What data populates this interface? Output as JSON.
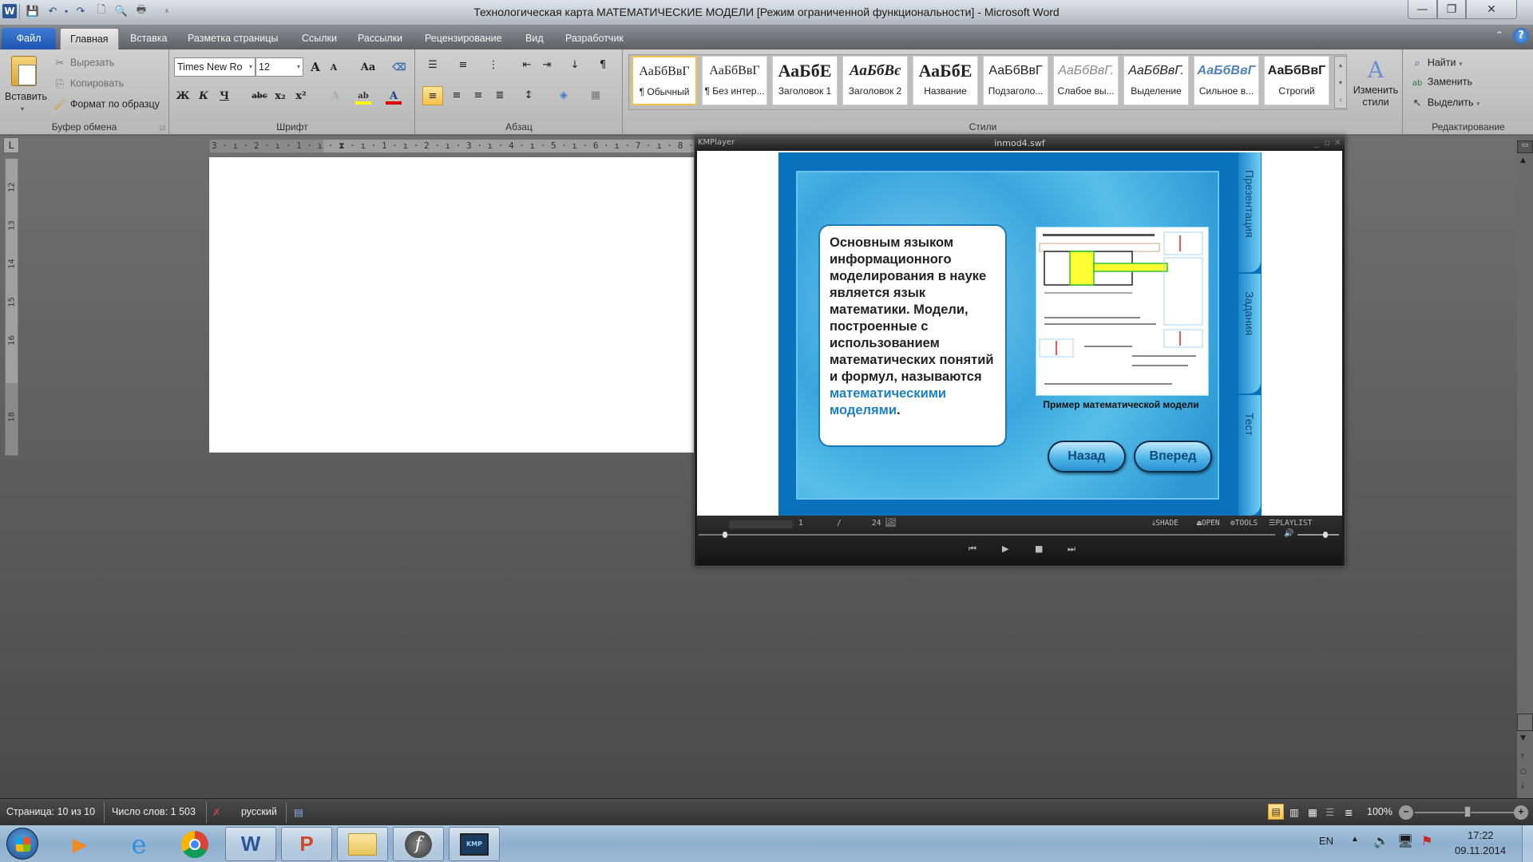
{
  "word": {
    "title": "Технологическая карта МАТЕМАТИЧЕСКИЕ  МОДЕЛИ [Режим ограниченной функциональности]  -  Microsoft Word",
    "quick_access": [
      "word-logo-icon",
      "save-icon",
      "undo-icon",
      "redo-icon",
      "new-document-icon",
      "print-preview-icon",
      "print-icon",
      "customize-icon"
    ],
    "window_controls": {
      "minimize": "—",
      "restore": "❐",
      "close": "✕"
    },
    "tabs": [
      {
        "label": "Файл",
        "id": "file"
      },
      {
        "label": "Главная",
        "id": "home",
        "active": true
      },
      {
        "label": "Вставка",
        "id": "insert"
      },
      {
        "label": "Разметка страницы",
        "id": "page-layout"
      },
      {
        "label": "Ссылки",
        "id": "references"
      },
      {
        "label": "Рассылки",
        "id": "mailings"
      },
      {
        "label": "Рецензирование",
        "id": "review"
      },
      {
        "label": "Вид",
        "id": "view"
      },
      {
        "label": "Разработчик",
        "id": "developer"
      }
    ],
    "ribbon": {
      "clipboard": {
        "label": "Буфер обмена",
        "paste": "Вставить",
        "cut": "Вырезать",
        "copy": "Копировать",
        "format_painter": "Формат по образцу"
      },
      "font": {
        "label": "Шрифт",
        "font_name": "Times New Ro",
        "font_size": "12",
        "bold": "Ж",
        "italic": "К",
        "underline": "Ч",
        "strike": "abc",
        "subscript": "x₂",
        "superscript": "x²",
        "grow": "A",
        "shrink": "A",
        "change_case": "Aa",
        "highlight_color": "#ffff00",
        "font_color": "#e00000"
      },
      "paragraph": {
        "label": "Абзац"
      },
      "styles": {
        "label": "Стили",
        "items": [
          {
            "sample": "АаБбВвГ",
            "name": "¶ Обычный",
            "selected": true
          },
          {
            "sample": "АаБбВвГ",
            "name": "¶ Без интер..."
          },
          {
            "sample": "АаБбЕ",
            "name": "Заголовок 1"
          },
          {
            "sample": "АаБбВє",
            "name": "Заголовок 2"
          },
          {
            "sample": "АаБбЕ",
            "name": "Название"
          },
          {
            "sample": "АаБбВвГ",
            "name": "Подзаголо..."
          },
          {
            "sample": "АаБбВвГ.",
            "name": "Слабое вы..."
          },
          {
            "sample": "АаБбВвГ.",
            "name": "Выделение"
          },
          {
            "sample": "АаБбВвГ",
            "name": "Сильное в..."
          },
          {
            "sample": "АаБбВвГ",
            "name": "Строгий"
          }
        ],
        "change_styles": "Изменить стили"
      },
      "editing": {
        "label": "Редактирование",
        "find": "Найти",
        "replace": "Заменить",
        "select": "Выделить"
      }
    },
    "ruler": {
      "horizontal": "3 · ı · 2 · ı · 1 · ı · ⧗ · ı · 1 · ı · 2 · ı · 3 · ı · 4 · ı · 5 · ı · 6 · ı · 7 · ı · 8 · ı · 9 · ı ·",
      "vertical": [
        "12",
        "13",
        "14",
        "15",
        "16",
        "18"
      ]
    },
    "status": {
      "page": "Страница: 10 из 10",
      "words": "Число слов: 1 503",
      "language": "русский",
      "zoom": "100%",
      "zoom_percent": 100
    }
  },
  "kmplayer": {
    "app": "KMPlayer",
    "file": "inmod4.swf",
    "flash": {
      "text_main": "Основным языком информационного моделирования в науке является язык математики. Модели, построенные с использованием математических понятий и формул, называются ",
      "text_highlight": "математическими моделями",
      "text_end": ".",
      "image_caption": "Пример математической модели",
      "back_button": "Назад",
      "forward_button": "Вперед",
      "side_tabs": [
        "Презентация",
        "Задания",
        "Тест"
      ],
      "accent": "#0a72bd"
    },
    "controls": {
      "frame": "1",
      "separator": "/",
      "total": "24",
      "rs": "RS",
      "shade": "SHADE",
      "open": "OPEN",
      "tools": "TOOLS",
      "playlist": "PLAYLIST"
    }
  },
  "taskbar": {
    "apps": [
      "windows-start",
      "media-player",
      "internet-explorer",
      "chrome",
      "word",
      "powerpoint",
      "explorer",
      "flash-player",
      "kmplayer"
    ],
    "lang": "EN",
    "time": "17:22",
    "date": "09.11.2014"
  }
}
